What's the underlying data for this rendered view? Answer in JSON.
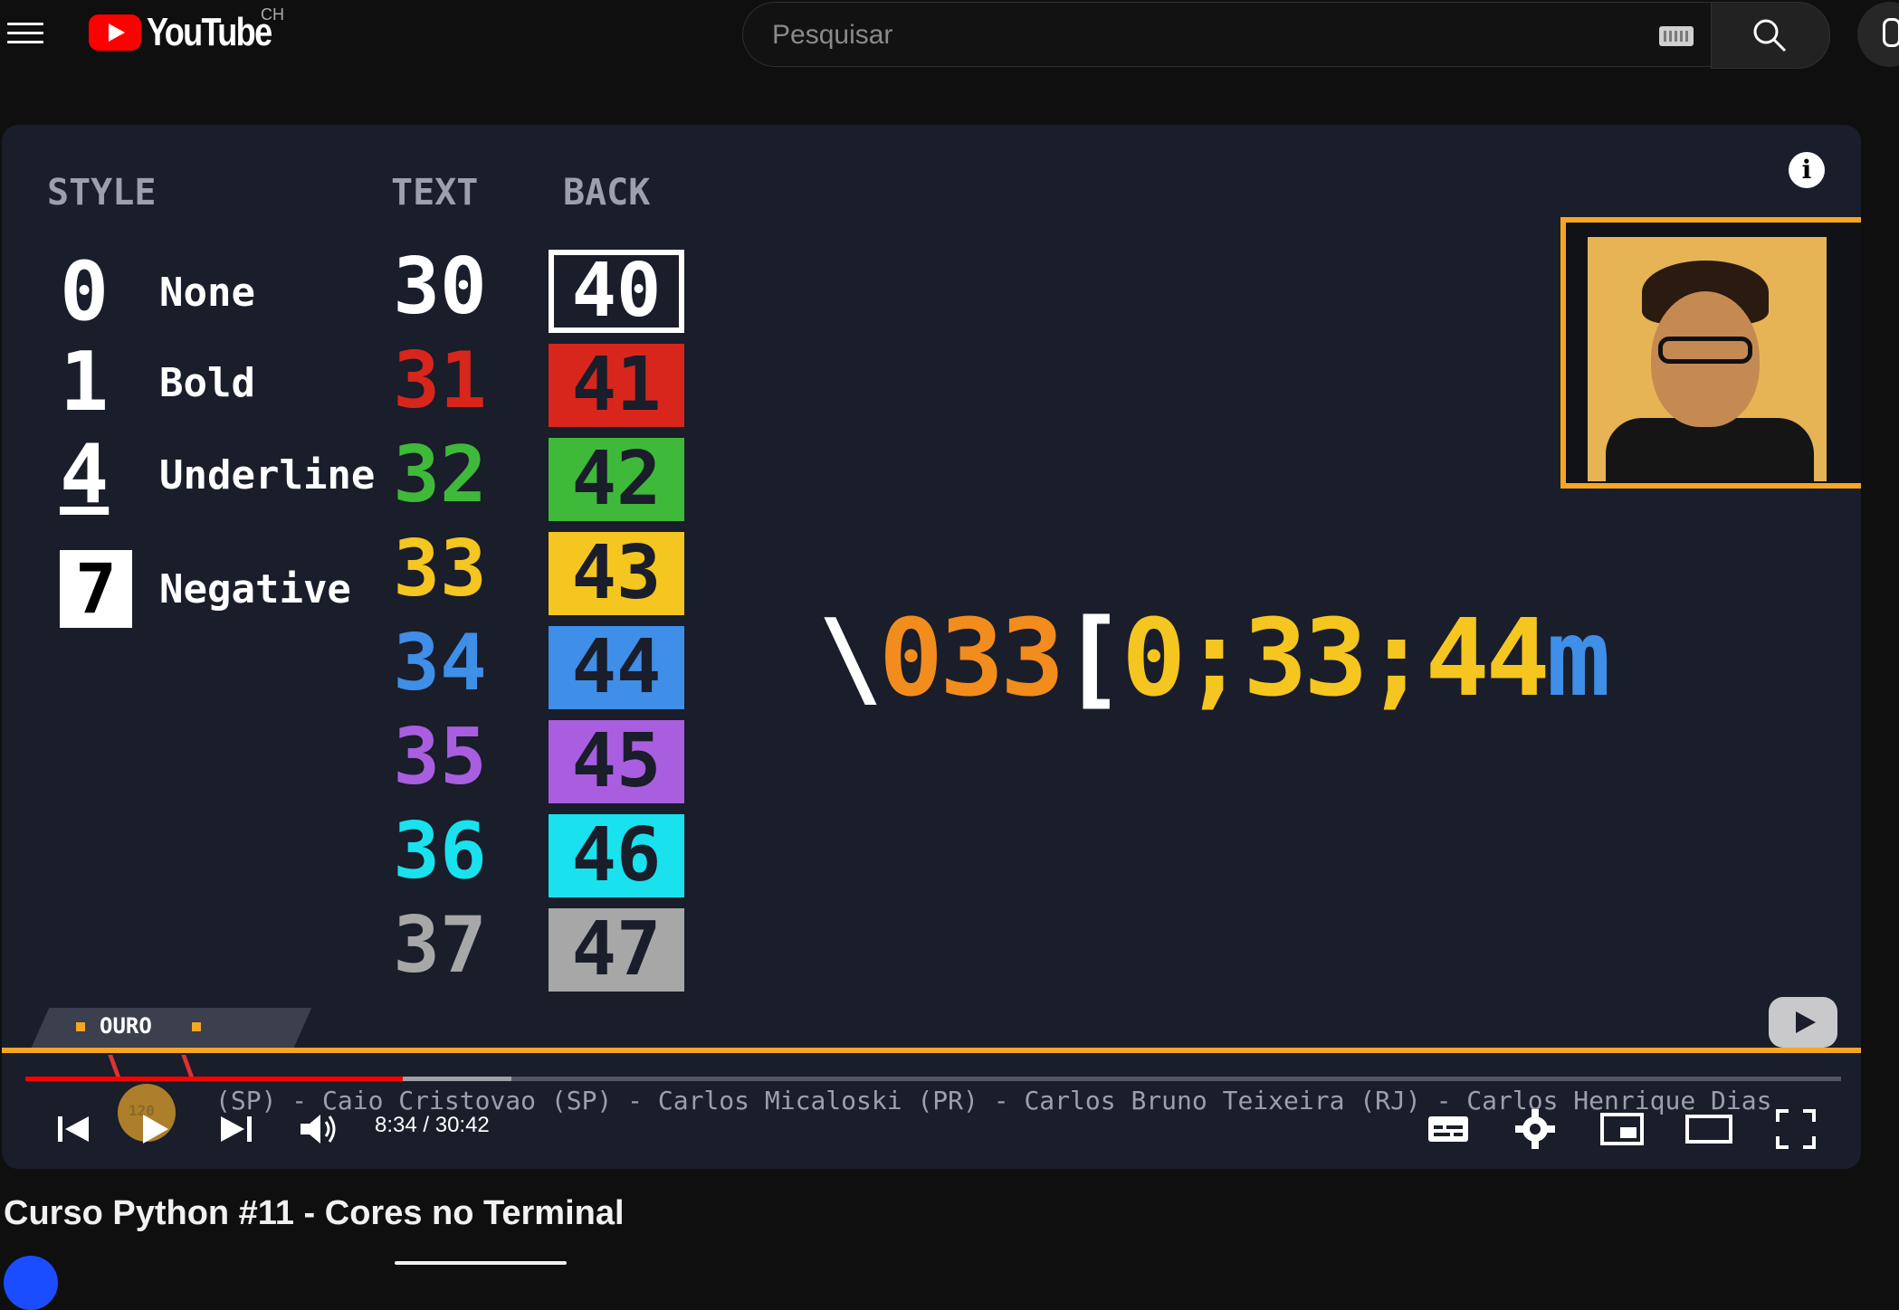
{
  "header": {
    "logo_text": "YouTube",
    "country_code": "CH",
    "search_placeholder": "Pesquisar"
  },
  "video": {
    "style_heading": "STYLE",
    "text_heading": "TEXT",
    "back_heading": "BACK",
    "styles": [
      {
        "num": "0",
        "label": "None"
      },
      {
        "num": "1",
        "label": "Bold"
      },
      {
        "num": "4",
        "label": "Underline"
      },
      {
        "num": "7",
        "label": "Negative"
      }
    ],
    "codes": [
      {
        "text": "30",
        "back": "40",
        "color": "#ffffff"
      },
      {
        "text": "31",
        "back": "41",
        "color": "#d8261c"
      },
      {
        "text": "32",
        "back": "42",
        "color": "#3fb93a"
      },
      {
        "text": "33",
        "back": "43",
        "color": "#f4c61f"
      },
      {
        "text": "34",
        "back": "44",
        "color": "#3f8ee8"
      },
      {
        "text": "35",
        "back": "45",
        "color": "#a95ee0"
      },
      {
        "text": "36",
        "back": "46",
        "color": "#19e1ee"
      },
      {
        "text": "37",
        "back": "47",
        "color": "#a7a7a7"
      }
    ],
    "escape_seq": {
      "slash": "\\",
      "code": "033",
      "bracket": "[",
      "style": "0;33;44",
      "end": "m"
    },
    "badge": "OURO",
    "medal_label": "120",
    "scroller_text": "(SP) - Caio Cristovao (SP) - Carlos Micaloski (PR) - Carlos Bruno Teixeira (RJ) - Carlos Henrique Dias"
  },
  "player": {
    "time_display": "8:34 / 30:42",
    "progress_played": 0.2791,
    "progress_buffered": 0.2591
  },
  "colors": {
    "accent": "#f5a623",
    "progress": "#ff0000",
    "panel_bg": "#1a1d2a"
  },
  "title": "Curso Python #11 - Cores no Terminal"
}
